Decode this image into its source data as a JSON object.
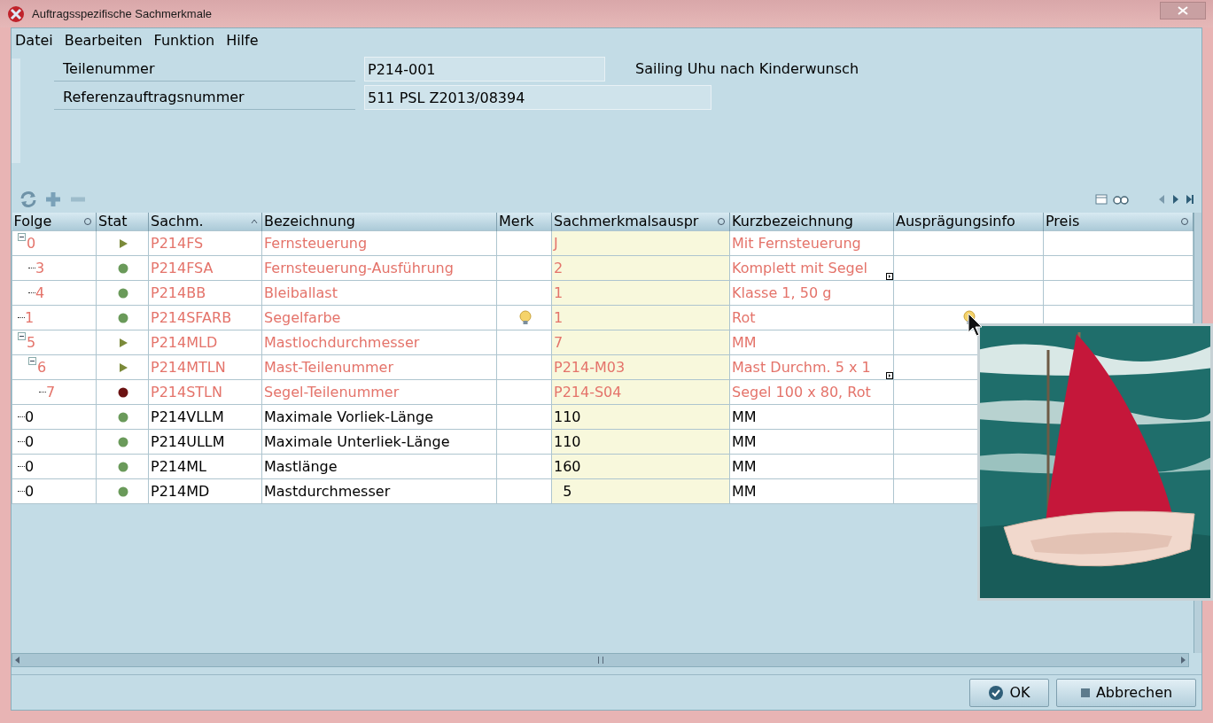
{
  "window": {
    "title": "Auftragsspezifische Sachmerkmale"
  },
  "menu": [
    "Datei",
    "Bearbeiten",
    "Funktion",
    "Hilfe"
  ],
  "form": {
    "fields": [
      {
        "label": "Teilenummer",
        "value": "P214-001",
        "note": "Sailing Uhu nach Kinderwunsch"
      },
      {
        "label": "Referenzauftragsnummer",
        "value": "511 PSL Z2013/08394"
      }
    ]
  },
  "table": {
    "columns": [
      {
        "label": "Folge",
        "kind": "circle"
      },
      {
        "label": "Stat",
        "kind": "plain"
      },
      {
        "label": "Sachm.",
        "kind": "sort"
      },
      {
        "label": "Bezeichnung",
        "kind": "plain"
      },
      {
        "label": "Merk",
        "kind": "plain"
      },
      {
        "label": "Sachmerkmalsauspr",
        "kind": "circle"
      },
      {
        "label": "Kurzbezeichnung",
        "kind": "plain"
      },
      {
        "label": "Ausprägungsinfo",
        "kind": "plain"
      },
      {
        "label": "Preis",
        "kind": "circle"
      }
    ],
    "rows": [
      {
        "folge": "0",
        "kind": "pending",
        "sachm": "P214FS",
        "bezeichnung": "Fernsteuerung",
        "value": "J",
        "kurz": "Mit Fernsteuerung",
        "modified": true,
        "expanded": true,
        "children": [
          {
            "folge": "3",
            "kind": "ok",
            "sachm": "P214FSA",
            "bezeichnung": "Fernsteuerung-Ausführung",
            "value": "2",
            "kurz": "Komplett mit Segel",
            "kurz_more": true,
            "modified": true
          },
          {
            "folge": "4",
            "kind": "ok",
            "sachm": "P214BB",
            "bezeichnung": "Bleiballast",
            "value": "1",
            "kurz": "Klasse 1, 50 g",
            "modified": true
          }
        ]
      },
      {
        "folge": "1",
        "kind": "ok",
        "sachm": "P214SFARB",
        "bezeichnung": "Segelfarbe",
        "merk_hint": true,
        "value": "1",
        "kurz": "Rot",
        "info_hint": true,
        "modified": true
      },
      {
        "folge": "5",
        "kind": "pending",
        "sachm": "P214MLD",
        "bezeichnung": "Mastlochdurchmesser",
        "value": "7",
        "kurz": "MM",
        "modified": true,
        "expanded": true,
        "children": [
          {
            "folge": "6",
            "kind": "pending",
            "sachm": "P214MTLN",
            "bezeichnung": "Mast-Teilenummer",
            "value": "P214-M03",
            "kurz": "Mast Durchm. 5 x 1",
            "kurz_more": true,
            "modified": true,
            "expanded": true,
            "children": [
              {
                "folge": "7",
                "kind": "error",
                "sachm": "P214STLN",
                "bezeichnung": "Segel-Teilenummer",
                "value": "P214-S04",
                "kurz": "Segel 100 x 80, Rot",
                "modified": true
              }
            ]
          }
        ]
      },
      {
        "folge": "0",
        "kind": "ok",
        "sachm": "P214VLLM",
        "bezeichnung": "Maximale Vorliek-Länge",
        "value": "110",
        "kurz": "MM",
        "modified": false
      },
      {
        "folge": "0",
        "kind": "ok",
        "sachm": "P214ULLM",
        "bezeichnung": "Maximale Unterliek-Länge",
        "value": "110",
        "kurz": "MM",
        "modified": false
      },
      {
        "folge": "0",
        "kind": "ok",
        "sachm": "P214ML",
        "bezeichnung": "Mastlänge",
        "value": "160",
        "kurz": "MM",
        "modified": false
      },
      {
        "folge": "0",
        "kind": "ok",
        "sachm": "P214MD",
        "bezeichnung": "Mastdurchmesser",
        "value": "  5",
        "kurz": "MM",
        "modified": false
      }
    ]
  },
  "buttons": [
    {
      "label": "OK",
      "kind": "ok"
    },
    {
      "label": "Abbrechen",
      "kind": "cancel"
    }
  ]
}
